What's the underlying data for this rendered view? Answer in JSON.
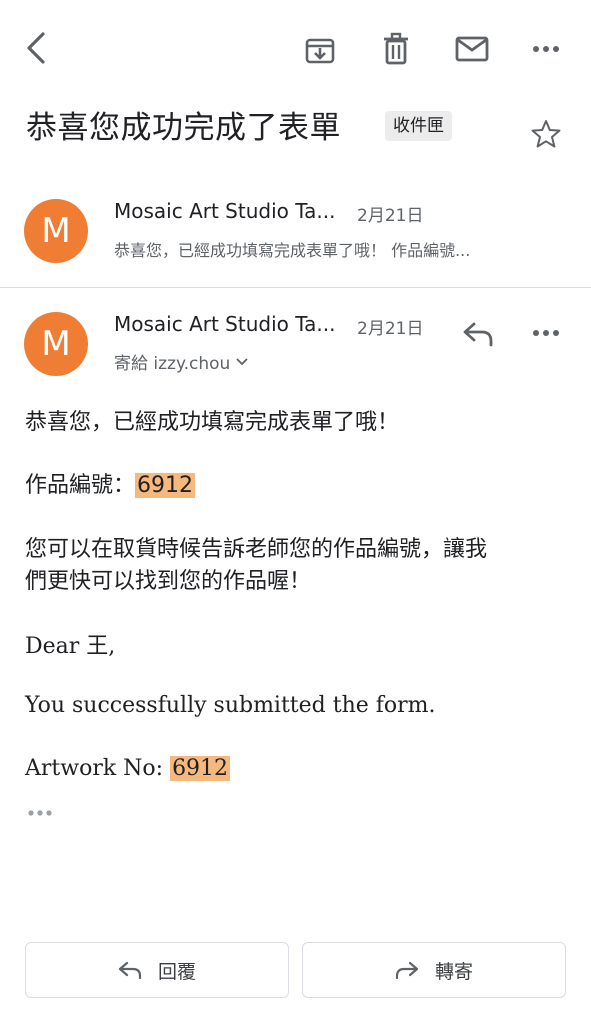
{
  "toolbar": {
    "back_icon": "back-arrow-icon",
    "archive_icon": "archive-icon",
    "delete_icon": "trash-icon",
    "mail_icon": "mail-icon",
    "more_icon": "more-icon"
  },
  "subject": {
    "title": "恭喜您成功完成了表單",
    "label": "收件匣"
  },
  "messages": [
    {
      "avatar_letter": "M",
      "sender": "Mosaic Art Studio Ta...",
      "date": "2月21日",
      "preview": "恭喜您，已經成功填寫完成表單了哦！ 作品編號..."
    },
    {
      "avatar_letter": "M",
      "sender": "Mosaic Art Studio Ta...",
      "date": "2月21日",
      "to": "寄給 izzy.chou"
    }
  ],
  "body": {
    "line1": "恭喜您，已經成功填寫完成表單了哦！",
    "artwork_label_cn": "作品編號：",
    "artwork_number": "6912",
    "line3a": "您可以在取貨時候告訴老師您的作品編號，讓我",
    "line3b": "們更快可以找到您的作品喔！",
    "dear": "Dear 王,",
    "submitted": "You successfully submitted the form.",
    "artwork_label_en": "Artwork No: ",
    "artwork_number_en": "6912"
  },
  "actions": {
    "reply_label": "回覆",
    "forward_label": "轉寄"
  },
  "colors": {
    "avatar": "#ef7d34",
    "highlight": "#f6b87c"
  }
}
